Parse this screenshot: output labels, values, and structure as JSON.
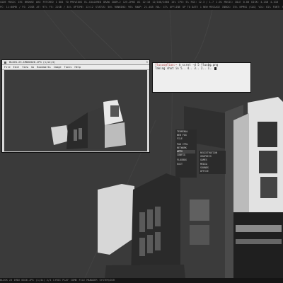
{
  "statusbar_top": [
    "CODE",
    "MUSIC",
    "IRC",
    "BROWSE",
    "#XX",
    "FETCHED",
    "1  884",
    "TO  PREVIOUS",
    "EL-COLOURED",
    "DRAW",
    "ZOOM-2",
    "125.2MHZ",
    "#1",
    "12:10",
    "12/108/1668",
    "15%",
    "CPU: 5%",
    "RSS: 12.3 / 1.7",
    "1.0%",
    "MUSIC: IDLE",
    "0.00",
    "DISK: 4.2GB",
    "4.1GB"
  ],
  "statusbar_top2": [
    "PC: 11:00MB",
    "/ FS: 22GB",
    "AT: 97%",
    "FS: 22GB",
    "/ 34%",
    "UPTIME: 12:12",
    "STATUS: 50%",
    "RUNNING: 96%",
    "SWAP: 21.4GB",
    "VOL: 47%",
    "OFFLINE",
    "UP TO DATE",
    "1 NEW MESSAGE",
    "INBOX: 35%",
    "NPMSG (SAG)",
    "VOL: 62%",
    "FONT: SC",
    "ENTER DISCLOSURE",
    "WEB: KENNY LOGGINS"
  ],
  "statusbar_bottom": [
    "BLOCK 23 1MDX 0026.JPG",
    "(1/4x) 2/4",
    "LYRIC PLAY",
    "COMB",
    "FILE MANAGER",
    "SYSTEM/DIR"
  ],
  "viewer": {
    "title": "BLOCK-23-1MDX0026.JPG  (1/x2/4)",
    "menu": [
      "File",
      "Edit",
      "View",
      "Go",
      "Bookmarks",
      "Image",
      "Tools",
      "Help"
    ]
  },
  "terminal": {
    "prompt": "fluxus@Tiao:~",
    "command": "$ scrot -d 5 fluxbg.png",
    "output": "Taking shot in 5.. 4.. 3.. 2.. 1.."
  },
  "menu_main": [
    "TERMINAL",
    "WEB FOX",
    "FILE",
    "",
    "PAD CTRL",
    "NETWORK",
    "APPS",
    "CONFIG",
    "",
    "FLUXBOX",
    "EXIT"
  ],
  "menu_main_selected": 6,
  "menu_sub": [
    "REGISTRATION",
    "GRAPHICS",
    "GAMES",
    "MEDIA",
    "SOUNDS",
    "OFFICE"
  ],
  "colors": {
    "desktop": "#3a3a3a",
    "statusbar_bg": "#151515",
    "statusbar_fg": "#8a8a8a",
    "menu_bg": "#2b2b2b"
  }
}
